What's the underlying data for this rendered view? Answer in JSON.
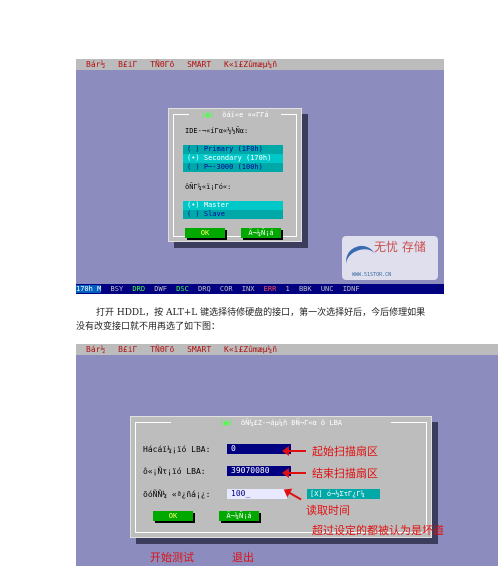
{
  "screen1": {
    "menu": [
      "Bár½",
      "B£iΓ",
      "TÑΘΓõ",
      "SMART",
      "K«ï£Zûmæµ¼ñ"
    ],
    "dialog": {
      "close": "[■]",
      "title": "õáï«e ¤«ΓΓá",
      "ide_label": "IDE-¬«íΓα«½½Ñα:",
      "ide_options": [
        "( ) Primary    (1F0h)",
        "(•) Secondary  (170h)",
        "( ) P~-3000    (100h)"
      ],
      "dev_label": "ôÑΓ¼«ï¡Γó«:",
      "dev_options": [
        "(•) Master",
        "( ) Slave"
      ],
      "ok": "OK",
      "cancel": "Ä¬¼Ñ¡á"
    },
    "status": [
      "170h M",
      "BSY",
      "DRD",
      "DWF",
      "DSC",
      "DRQ",
      "COR",
      "INX",
      "ERR",
      "1",
      "BBK",
      "UNC",
      "IDNF"
    ]
  },
  "watermark": {
    "text": "无忧 存储",
    "url": "WWW.51STOR.CN"
  },
  "caption": "打开 HDDL，按 ALT+L 键选择待修硬盘的接口，第一次选择好后，今后修理如果没有改变接口就不用再选了如下图：",
  "screen2": {
    "menu": [
      "Bár½",
      "B£iΓ",
      "TÑΘΓõ",
      "SMART",
      "K«ï£Zûmæµ¼ñ"
    ],
    "dialog": {
      "close": "[■]",
      "title": "õÑ¼£Z-¬áµ¼ñ ÐÑ¬Γ«α ô LBA",
      "start_label": "Hácáï¼¡ïó LBA:",
      "start_value": "0",
      "end_label": "ô«¡Ñτ¡ïó  LBA:",
      "end_value": "39070080",
      "time_label": "õóÑÑ¼ «ª¿ñá¡¿:",
      "time_value": "100_",
      "check": "[X] ó¬½ΣτΓ¿Γ¼",
      "ok": "OK",
      "cancel": "Ä¬¼Ñ¡á"
    },
    "annotations": {
      "start": "起始扫描扇区",
      "end": "结束扫描扇区",
      "time": "读取时间",
      "bad": "超过设定的都被认为是坏道",
      "start_test": "开始测试",
      "exit": "退出"
    }
  }
}
